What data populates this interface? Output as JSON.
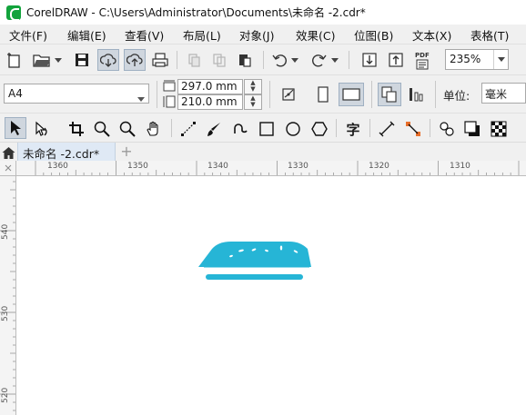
{
  "window": {
    "title": "CorelDRAW - C:\\Users\\Administrator\\Documents\\未命名 -2.cdr*"
  },
  "menu": {
    "items": [
      {
        "label": "文件(F)"
      },
      {
        "label": "编辑(E)"
      },
      {
        "label": "查看(V)"
      },
      {
        "label": "布局(L)"
      },
      {
        "label": "对象(J)"
      },
      {
        "label": "效果(C)"
      },
      {
        "label": "位图(B)"
      },
      {
        "label": "文本(X)"
      },
      {
        "label": "表格(T)"
      }
    ]
  },
  "standard_toolbar": {
    "zoom_value": "235%",
    "pdf_label": "PDF",
    "icons": [
      "new-document-icon",
      "open-icon",
      "save-icon",
      "cloud-download-icon",
      "cloud-upload-icon",
      "print-icon",
      "cut-icon",
      "copy-icon",
      "paste-icon",
      "undo-icon",
      "redo-icon",
      "import-icon",
      "export-icon",
      "publish-pdf-icon"
    ]
  },
  "property_bar": {
    "page_size": "A4",
    "width": "297.0 mm",
    "height": "210.0 mm",
    "unit_label": "单位:",
    "unit_value": "毫米"
  },
  "toolbox": {
    "tools": [
      "pick-tool-icon",
      "shape-tool-icon",
      "crop-tool-icon",
      "zoom-tool-icon",
      "zoom-out-tool-icon",
      "pan-tool-icon",
      "freehand-tool-icon",
      "artistic-media-tool-icon",
      "bezier-tool-icon",
      "rectangle-tool-icon",
      "ellipse-tool-icon",
      "polygon-tool-icon",
      "text-tool-icon",
      "parallel-dimension-tool-icon",
      "connector-tool-icon",
      "blend-tool-icon",
      "drop-shadow-tool-icon",
      "transparency-tool-icon"
    ],
    "text_tool_glyph": "字"
  },
  "tabs": {
    "document_tab": "未命名 -2.cdr*",
    "add_tab": "+"
  },
  "rulers": {
    "horizontal_labels": [
      "1360",
      "1350",
      "1340",
      "1330",
      "1320",
      "1310"
    ],
    "vertical_labels": [
      "540",
      "530",
      "520"
    ]
  },
  "colors": {
    "toolbar_bg": "#f0f0f0",
    "tab_active": "#dfe9f5",
    "artwork": "#26b5d6",
    "brand_green": "#12a33c"
  }
}
